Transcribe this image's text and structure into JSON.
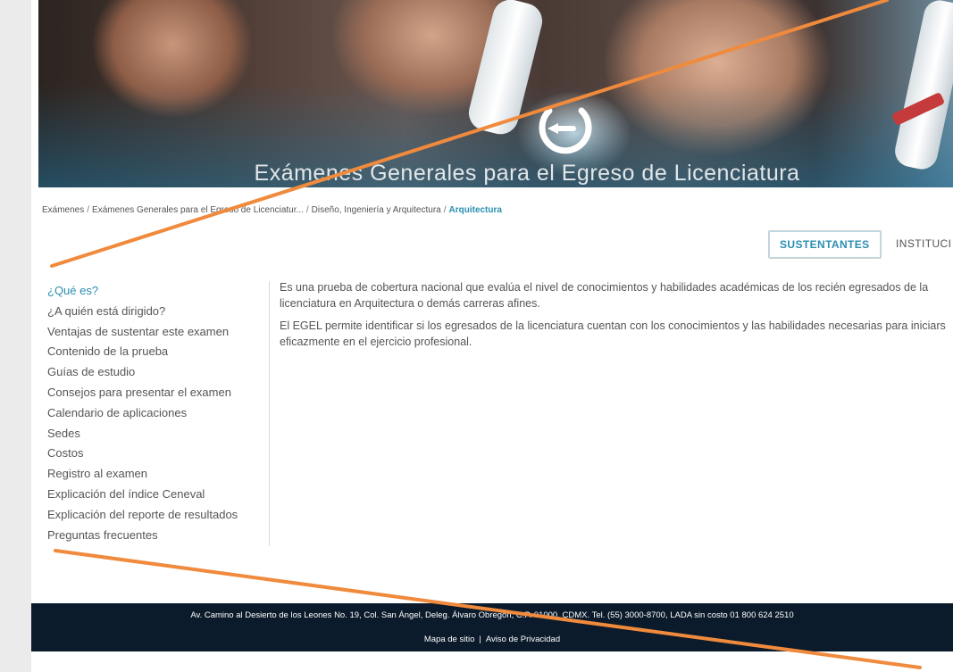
{
  "hero": {
    "title": "Exámenes Generales para el Egreso de Licenciatura"
  },
  "breadcrumb": {
    "items": [
      "Exámenes",
      "Exámenes Generales para el Egreso de Licenciatur...",
      "Diseño, Ingeniería y Arquitectura"
    ],
    "separator": "/",
    "current": "Arquitectura"
  },
  "tabs": [
    {
      "label": "SUSTENTANTES",
      "active": true
    },
    {
      "label": "INSTITUCI",
      "active": false
    }
  ],
  "sidebar": {
    "items": [
      {
        "label": "¿Qué es?",
        "active": true
      },
      {
        "label": "¿A quién está dirigido?"
      },
      {
        "label": "Ventajas de sustentar este examen"
      },
      {
        "label": "Contenido de la prueba"
      },
      {
        "label": "Guías de estudio"
      },
      {
        "label": "Consejos para presentar el examen"
      },
      {
        "label": "Calendario de aplicaciones"
      },
      {
        "label": "Sedes"
      },
      {
        "label": "Costos"
      },
      {
        "label": "Registro al examen"
      },
      {
        "label": "Explicación del índice Ceneval"
      },
      {
        "label": "Explicación del reporte de resultados"
      },
      {
        "label": "Preguntas frecuentes"
      }
    ]
  },
  "content": {
    "paragraphs": [
      "Es una prueba de cobertura nacional que evalúa el nivel de conocimientos y habilidades académicas de los recién egresados de la licenciatura en Arquitectura o demás carreras afines.",
      "El EGEL permite identificar si los egresados de la licenciatura cuentan con los conocimientos y las habilidades necesarias para iniciars eficazmente en el ejercicio profesional."
    ]
  },
  "footer": {
    "address": "Av. Camino al Desierto de los Leones No. 19, Col. San Ángel, Deleg. Álvaro Obregón, C.P. 01000, CDMX. Tel. (55) 3000-8700, LADA sin costo 01 800 624 2510",
    "links": [
      "Mapa de sitio",
      "Aviso de Privacidad"
    ],
    "links_separator": "|"
  },
  "colors": {
    "accent": "#2a8fb0",
    "footer_bg": "#0b1b2b",
    "annotation": "#f08a3c"
  }
}
